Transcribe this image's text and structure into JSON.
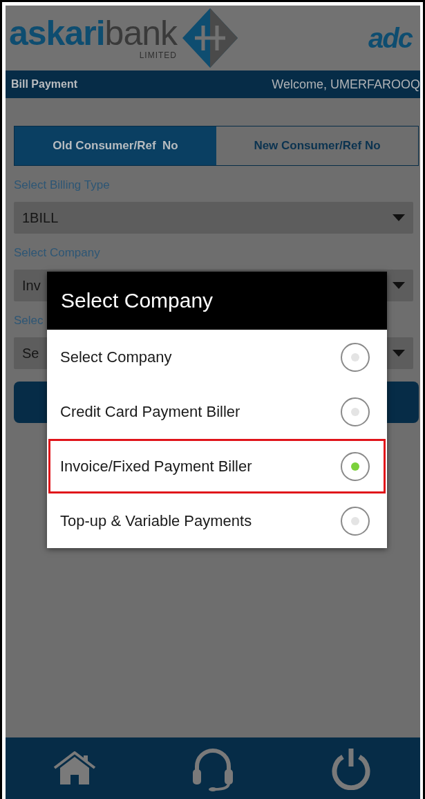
{
  "header": {
    "logo": {
      "brand_bold": "askari",
      "brand_light": "bank",
      "tagline": "LIMITED"
    },
    "partner_logo": "adc"
  },
  "title_bar": {
    "title": "Bill Payment",
    "welcome": "Welcome, UMERFAROOQ"
  },
  "tabs": [
    {
      "label": "Old Consumer/Ref  No",
      "selected": true
    },
    {
      "label": "New Consumer/Ref No",
      "selected": false
    }
  ],
  "form": [
    {
      "label": "Select Billing Type",
      "value": "1BILL"
    },
    {
      "label": "Select Company",
      "value": "Inv"
    },
    {
      "label": "Selec",
      "value": "Se"
    }
  ],
  "dialog": {
    "title": "Select Company",
    "options": [
      {
        "label": "Select Company",
        "selected": false,
        "highlighted": false
      },
      {
        "label": "Credit Card Payment Biller",
        "selected": false,
        "highlighted": false
      },
      {
        "label": "Invoice/Fixed Payment Biller",
        "selected": true,
        "highlighted": true
      },
      {
        "label": "Top-up & Variable Payments",
        "selected": false,
        "highlighted": false
      }
    ]
  }
}
